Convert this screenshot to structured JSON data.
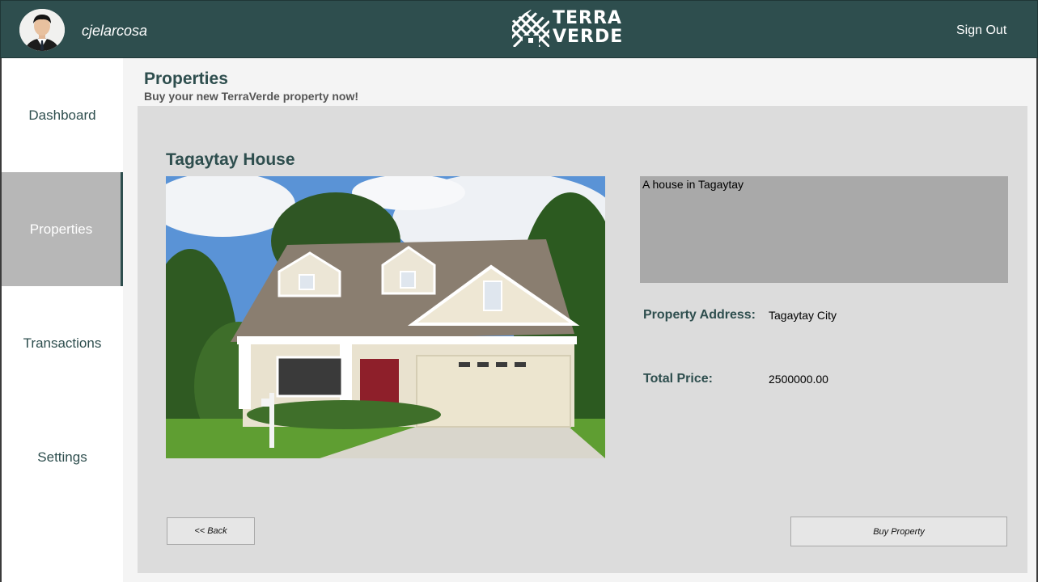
{
  "header": {
    "username": "cjelarcosa",
    "logo_line1": "TERRA",
    "logo_line2": "VERDE",
    "signout_label": "Sign Out"
  },
  "sidebar": {
    "items": [
      {
        "label": "Dashboard"
      },
      {
        "label": "Properties",
        "active": true
      },
      {
        "label": "Transactions"
      },
      {
        "label": "Settings"
      }
    ]
  },
  "page": {
    "title": "Properties",
    "subtitle": "Buy your new TerraVerde property now!"
  },
  "property": {
    "name": "Tagaytay House",
    "description": "A house in Tagaytay",
    "address_label": "Property Address:",
    "address": "Tagaytay City",
    "price_label": "Total Price:",
    "price": "2500000.00"
  },
  "buttons": {
    "back_label": "<< Back",
    "buy_label": "Buy Property"
  },
  "colors": {
    "brand": "#2e4e4e",
    "panel": "#dcdcdc",
    "active_nav": "#b7b7b7",
    "desc_box": "#a9a9a9"
  }
}
